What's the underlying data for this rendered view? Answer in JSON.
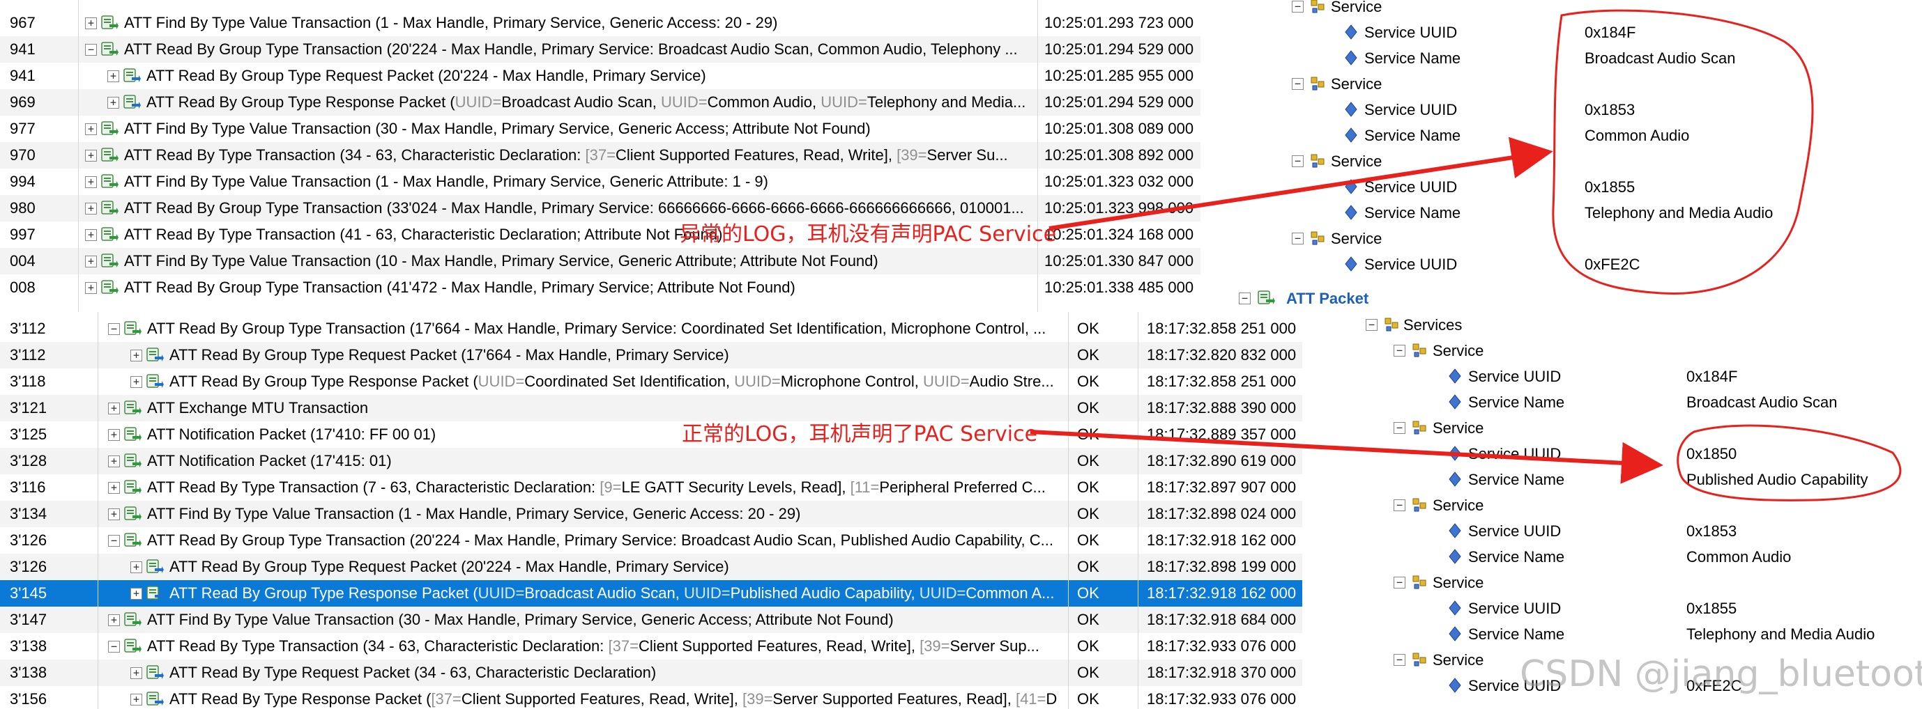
{
  "top_list": {
    "rows": [
      {
        "idx": "967",
        "exp": "+",
        "desc": "ATT Find By Type Value Transaction (1 - Max Handle, Primary Service, Generic Access: 20 - 29)",
        "desc_dim": "",
        "time": "10:25:01.293 723 000"
      },
      {
        "idx": "941",
        "exp": "−",
        "desc": "ATT Read By Group Type Transaction (20'224 - Max Handle, Primary Service: Broadcast Audio Scan, Common Audio, Telephony ...",
        "desc_dim": "",
        "time": "10:25:01.294 529 000"
      },
      {
        "idx": "941",
        "exp": "+",
        "child": true,
        "desc": "ATT Read By Group Type Request Packet (20'224 - Max Handle, Primary Service)",
        "desc_dim": "",
        "time": "10:25:01.285 955 000"
      },
      {
        "idx": "969",
        "exp": "+",
        "child": true,
        "desc": "ATT Read By Group Type Response Packet (UUID=Broadcast Audio Scan, UUID=Common Audio, UUID=Telephony and Media...",
        "desc_dim": "",
        "time": "10:25:01.294 529 000"
      },
      {
        "idx": "977",
        "exp": "+",
        "desc": "ATT Find By Type Value Transaction (30 - Max Handle, Primary Service, Generic Access; Attribute Not Found)",
        "desc_dim": "",
        "time": "10:25:01.308 089 000"
      },
      {
        "idx": "970",
        "exp": "+",
        "desc": "ATT Read By Type Transaction (34 - 63, Characteristic Declaration: [37=Client Supported Features, Read, Write], [39=Server Su...",
        "desc_dim": "",
        "time": "10:25:01.308 892 000"
      },
      {
        "idx": "994",
        "exp": "+",
        "desc": "ATT Find By Type Value Transaction (1 - Max Handle, Primary Service, Generic Attribute: 1 - 9)",
        "desc_dim": "",
        "time": "10:25:01.323 032 000"
      },
      {
        "idx": "980",
        "exp": "+",
        "desc": "ATT Read By Group Type Transaction (33'024 - Max Handle, Primary Service: 66666666-6666-6666-6666-666666666666, 010001...",
        "desc_dim": "",
        "time": "10:25:01.323 998 000"
      },
      {
        "idx": "997",
        "exp": "+",
        "desc": "ATT Read By Type Transaction (41 - 63, Characteristic Declaration; Attribute Not Found)",
        "desc_dim": "",
        "time": "10:25:01.324 168 000"
      },
      {
        "idx": "004",
        "exp": "+",
        "desc": "ATT Find By Type Value Transaction (10 - Max Handle, Primary Service, Generic Attribute; Attribute Not Found)",
        "desc_dim": "",
        "time": "10:25:01.330 847 000"
      },
      {
        "idx": "008",
        "exp": "+",
        "desc": "ATT Read By Group Type Transaction (41'472 - Max Handle, Primary Service; Attribute Not Found)",
        "desc_dim": "",
        "time": "10:25:01.338 485 000"
      }
    ]
  },
  "top_tree": {
    "items": [
      {
        "type": "service",
        "label": "Service"
      },
      {
        "type": "field",
        "label": "Service UUID",
        "value": "0x184F"
      },
      {
        "type": "field",
        "label": "Service Name",
        "value": "Broadcast Audio Scan"
      },
      {
        "type": "service",
        "label": "Service"
      },
      {
        "type": "field",
        "label": "Service UUID",
        "value": "0x1853"
      },
      {
        "type": "field",
        "label": "Service Name",
        "value": "Common Audio"
      },
      {
        "type": "service",
        "label": "Service"
      },
      {
        "type": "field",
        "label": "Service UUID",
        "value": "0x1855"
      },
      {
        "type": "field",
        "label": "Service Name",
        "value": "Telephony and Media Audio"
      },
      {
        "type": "service",
        "label": "Service"
      },
      {
        "type": "field",
        "label": "Service UUID",
        "value": "0xFE2C"
      }
    ],
    "att_packet_label": "ATT Packet"
  },
  "bottom_list": {
    "rows": [
      {
        "idx": "3'112",
        "exp": "−",
        "desc": "ATT Read By Group Type Transaction (17'664 - Max Handle, Primary Service: Coordinated Set Identification, Microphone Control, ...",
        "stat": "OK",
        "time": "18:17:32.858 251 000"
      },
      {
        "idx": "3'112",
        "exp": "+",
        "child": true,
        "desc": "ATT Read By Group Type Request Packet (17'664 - Max Handle, Primary Service)",
        "stat": "OK",
        "time": "18:17:32.820 832 000"
      },
      {
        "idx": "3'118",
        "exp": "+",
        "child": true,
        "desc": "ATT Read By Group Type Response Packet (UUID=Coordinated Set Identification, UUID=Microphone Control, UUID=Audio Stre...",
        "stat": "OK",
        "time": "18:17:32.858 251 000"
      },
      {
        "idx": "3'121",
        "exp": "+",
        "desc": "ATT Exchange MTU Transaction",
        "stat": "OK",
        "time": "18:17:32.888 390 000"
      },
      {
        "idx": "3'125",
        "exp": "+",
        "desc": "ATT Notification Packet (17'410: FF 00 01)",
        "stat": "OK",
        "time": "18:17:32.889 357 000"
      },
      {
        "idx": "3'128",
        "exp": "+",
        "desc": "ATT Notification Packet (17'415: 01)",
        "stat": "OK",
        "time": "18:17:32.890 619 000"
      },
      {
        "idx": "3'116",
        "exp": "+",
        "desc": "ATT Read By Type Transaction (7 - 63, Characteristic Declaration: [9=LE GATT Security Levels, Read], [11=Peripheral Preferred C...",
        "stat": "OK",
        "time": "18:17:32.897 907 000"
      },
      {
        "idx": "3'134",
        "exp": "+",
        "desc": "ATT Find By Type Value Transaction (1 - Max Handle, Primary Service, Generic Access: 20 - 29)",
        "stat": "OK",
        "time": "18:17:32.898 024 000"
      },
      {
        "idx": "3'126",
        "exp": "−",
        "desc": "ATT Read By Group Type Transaction (20'224 - Max Handle, Primary Service: Broadcast Audio Scan, Published Audio Capability, C...",
        "stat": "OK",
        "time": "18:17:32.918 162 000"
      },
      {
        "idx": "3'126",
        "exp": "+",
        "child": true,
        "desc": "ATT Read By Group Type Request Packet (20'224 - Max Handle, Primary Service)",
        "stat": "OK",
        "time": "18:17:32.898 199 000"
      },
      {
        "idx": "3'145",
        "exp": "+",
        "child": true,
        "selected": true,
        "desc": "ATT Read By Group Type Response Packet (UUID=Broadcast Audio Scan, UUID=Published Audio Capability, UUID=Common A...",
        "stat": "OK",
        "time": "18:17:32.918 162 000"
      },
      {
        "idx": "3'147",
        "exp": "+",
        "desc": "ATT Find By Type Value Transaction (30 - Max Handle, Primary Service, Generic Access; Attribute Not Found)",
        "stat": "OK",
        "time": "18:17:32.918 684 000"
      },
      {
        "idx": "3'138",
        "exp": "−",
        "desc": "ATT Read By Type Transaction (34 - 63, Characteristic Declaration: [37=Client Supported Features, Read, Write], [39=Server Sup...",
        "stat": "OK",
        "time": "18:17:32.933 076 000"
      },
      {
        "idx": "3'138",
        "exp": "+",
        "child": true,
        "desc": "ATT Read By Type Request Packet (34 - 63, Characteristic Declaration)",
        "stat": "OK",
        "time": "18:17:32.918 370 000"
      },
      {
        "idx": "3'156",
        "exp": "+",
        "child": true,
        "desc": "ATT Read By Type Response Packet ([37=Client Supported Features, Read, Write], [39=Server Supported Features, Read], [41=D",
        "stat": "OK",
        "time": "18:17:32.933 076 000"
      }
    ]
  },
  "bottom_tree": {
    "services_label": "Services",
    "items": [
      {
        "type": "service",
        "label": "Service"
      },
      {
        "type": "field",
        "label": "Service UUID",
        "value": "0x184F"
      },
      {
        "type": "field",
        "label": "Service Name",
        "value": "Broadcast Audio Scan"
      },
      {
        "type": "service",
        "label": "Service"
      },
      {
        "type": "field",
        "label": "Service UUID",
        "value": "0x1850"
      },
      {
        "type": "field",
        "label": "Service Name",
        "value": "Published Audio Capability"
      },
      {
        "type": "service",
        "label": "Service"
      },
      {
        "type": "field",
        "label": "Service UUID",
        "value": "0x1853"
      },
      {
        "type": "field",
        "label": "Service Name",
        "value": "Common Audio"
      },
      {
        "type": "service",
        "label": "Service"
      },
      {
        "type": "field",
        "label": "Service UUID",
        "value": "0x1855"
      },
      {
        "type": "field",
        "label": "Service Name",
        "value": "Telephony and Media Audio"
      },
      {
        "type": "service",
        "label": "Service"
      },
      {
        "type": "field",
        "label": "Service UUID",
        "value": "0xFE2C"
      }
    ]
  },
  "annotations": {
    "abnormal": "异常的LOG，耳机没有声明PAC Service",
    "normal": "正常的LOG，耳机声明了PAC Service",
    "color": "#e8211c"
  },
  "watermark": "CSDN @jiang_bluetooth",
  "colors": {
    "selected_row": "#0a7ad6",
    "dim_text": "#909090",
    "packet_icon": "#2e9a3a"
  }
}
